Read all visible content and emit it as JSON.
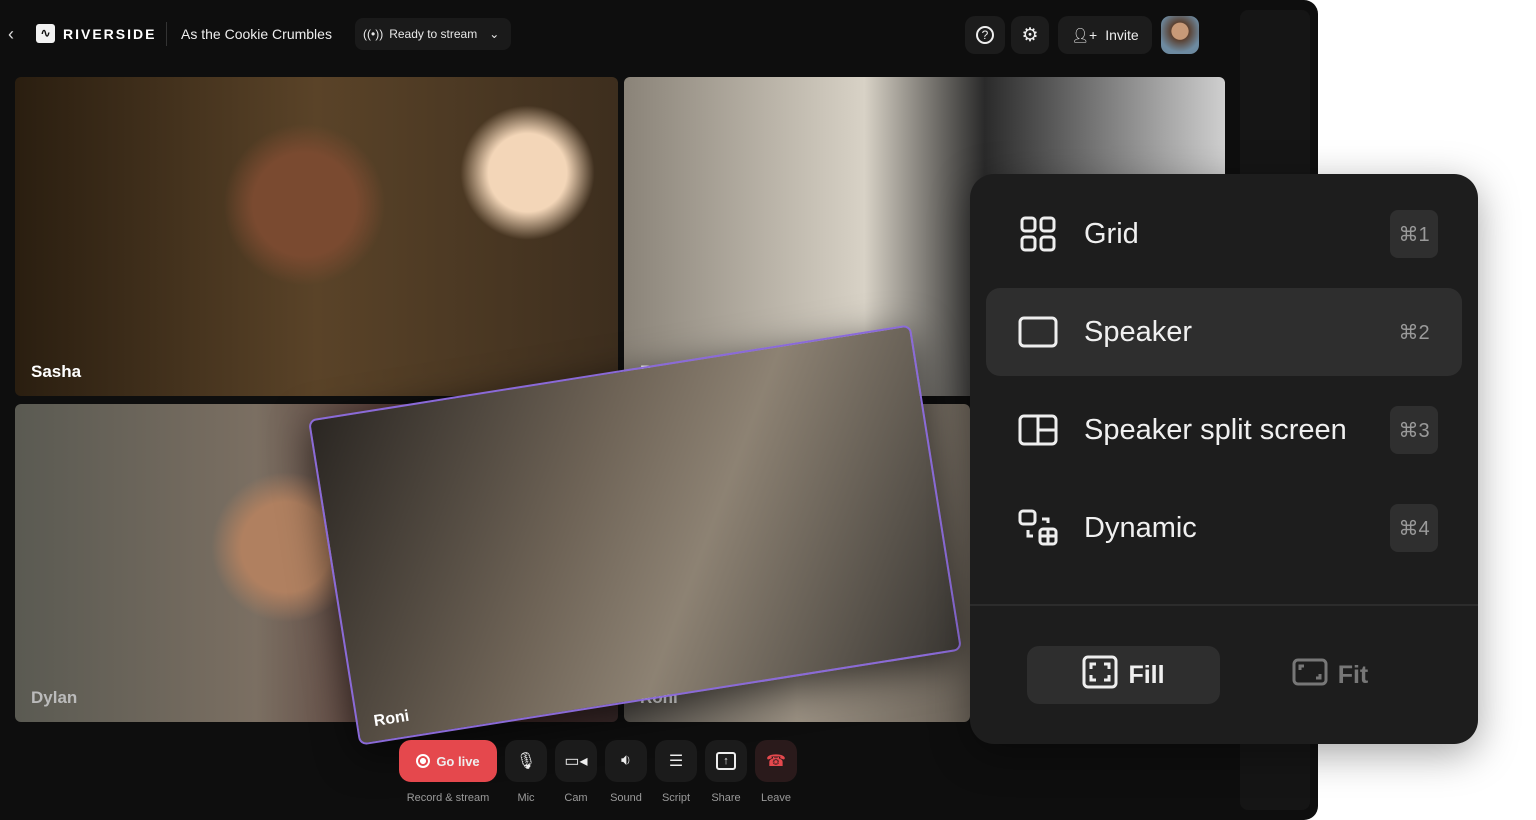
{
  "header": {
    "back_icon": "chevron-left-icon",
    "logo": "RIVERSIDE",
    "session_title": "As the Cookie Crumbles",
    "status": "Ready to stream",
    "invite": "Invite"
  },
  "participants": [
    {
      "name": "Sasha"
    },
    {
      "name": "Ro"
    },
    {
      "name": "Dylan"
    },
    {
      "name": "Roni"
    },
    {
      "name": "Roni"
    }
  ],
  "controls": [
    {
      "label": "Go live",
      "caption": "Record & stream",
      "icon": "record-icon"
    },
    {
      "caption": "Mic",
      "icon": "mic-icon"
    },
    {
      "caption": "Cam",
      "icon": "camera-icon"
    },
    {
      "caption": "Sound",
      "icon": "speaker-icon"
    },
    {
      "caption": "Script",
      "icon": "script-icon"
    },
    {
      "caption": "Share",
      "icon": "share-icon"
    },
    {
      "caption": "Leave",
      "icon": "phone-hangup-icon"
    }
  ],
  "layout_menu": {
    "items": [
      {
        "label": "Grid",
        "shortcut": "⌘1",
        "icon": "grid-icon"
      },
      {
        "label": "Speaker",
        "shortcut": "⌘2",
        "icon": "speaker-layout-icon",
        "selected": true
      },
      {
        "label": "Speaker split screen",
        "shortcut": "⌘3",
        "icon": "split-screen-icon"
      },
      {
        "label": "Dynamic",
        "shortcut": "⌘4",
        "icon": "dynamic-layout-icon"
      }
    ],
    "fill": "Fill",
    "fit": "Fit",
    "fill_selected": true
  },
  "colors": {
    "accent": "#8a6ad8",
    "live": "#e5484d",
    "leave": "#e5484d"
  }
}
